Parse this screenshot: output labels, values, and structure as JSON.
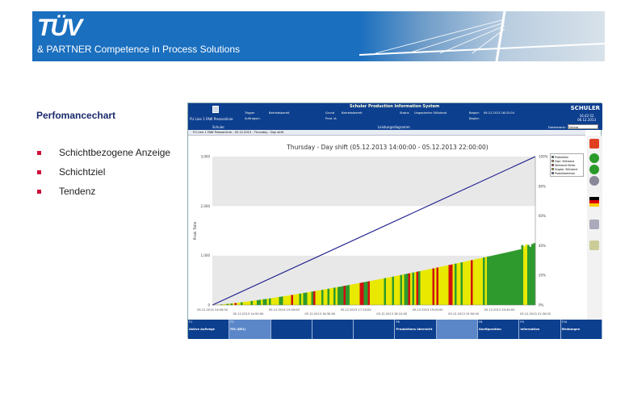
{
  "header": {
    "logo": "TÜV",
    "tagline": "& PARTNER  Competence in Process Solutions"
  },
  "slide": {
    "heading": "Perfomancechart",
    "bullets": [
      "Schichtbezogene Anzeige",
      "Schichtziel",
      "Tendenz"
    ]
  },
  "app": {
    "system": "FU Line 1  FAW Pressenlinie",
    "title": "Schuler Production Information System",
    "fields": {
      "trigger_label": "Trigger",
      "trigger_value": "Betriebsbereit",
      "grund_label": "Grund",
      "grund_value": "Betriebsbereit",
      "status_label": "Status",
      "status_value": "Ungeplanter Stillstand",
      "beginn_label": "Beginn",
      "beginn_value": "06.12.2013 16:02:04",
      "auftrag_label": "Auftragsm.",
      "prod_label": "Prod. st.",
      "beginn2_label": "Beginn"
    },
    "brand": "SCHULER",
    "clock_time": "16:42:52",
    "clock_date": "06.12.2013",
    "sub_left": "Schuler",
    "sub_center": "Leistungsdiagramm",
    "db_label": "Datenbank:",
    "db_value": "Online",
    "crumb": "FU Line 1  FAW Pressenlinie - 05.12.2013 - Thursday - Day shift",
    "fkeys": [
      {
        "n": "F1",
        "l": "Aktive Aufträge"
      },
      {
        "n": "F2",
        "l": "PIS (DE1)"
      },
      {
        "n": "",
        "l": ""
      },
      {
        "n": "",
        "l": ""
      },
      {
        "n": "",
        "l": ""
      },
      {
        "n": "F6",
        "l": "Produktions übersicht"
      },
      {
        "n": "",
        "l": ""
      },
      {
        "n": "F8",
        "l": "Konfiguration"
      },
      {
        "n": "F9",
        "l": "Information"
      },
      {
        "n": "F10",
        "l": "Meldungen"
      }
    ]
  },
  "chart_data": {
    "type": "area",
    "title": "Thursday - Day shift (05.12.2013 14:00:00 - 05.12.2013 22:00:00)",
    "ylabel": "Prod. Teile",
    "ylim": [
      0,
      3000
    ],
    "y_ticks": [
      "0",
      "1,000",
      "2,000",
      "3,000"
    ],
    "y2_ticks": [
      "0%",
      "20%",
      "40%",
      "60%",
      "80%",
      "100%"
    ],
    "x_ticks": [
      "05.12.2013 14:00:00",
      "05.12.2013 14:50:00",
      "05.12.2013 15:40:00",
      "05.12.2013 16:30:00",
      "05.12.2013 17:20:00",
      "05.12.2013 18:10:00",
      "05.12.2013 19:00:00",
      "05.12.2013 19:50:00",
      "05.12.2013 20:40:00",
      "05.12.2013 21:30:00"
    ],
    "target_line": {
      "from": 0,
      "to": 3000
    },
    "produced_end": 1200,
    "legend": [
      {
        "name": "Produktion",
        "color": "#2e9a2e"
      },
      {
        "name": "Gepl. Stillstand",
        "color": "#f0a050"
      },
      {
        "name": "Stillstand Fehler",
        "color": "#d01010"
      },
      {
        "name": "Ungepl. Stillstand",
        "color": "#e8e800"
      },
      {
        "name": "Produktwechsel",
        "color": "#4a6ad8"
      }
    ],
    "grid": true
  }
}
